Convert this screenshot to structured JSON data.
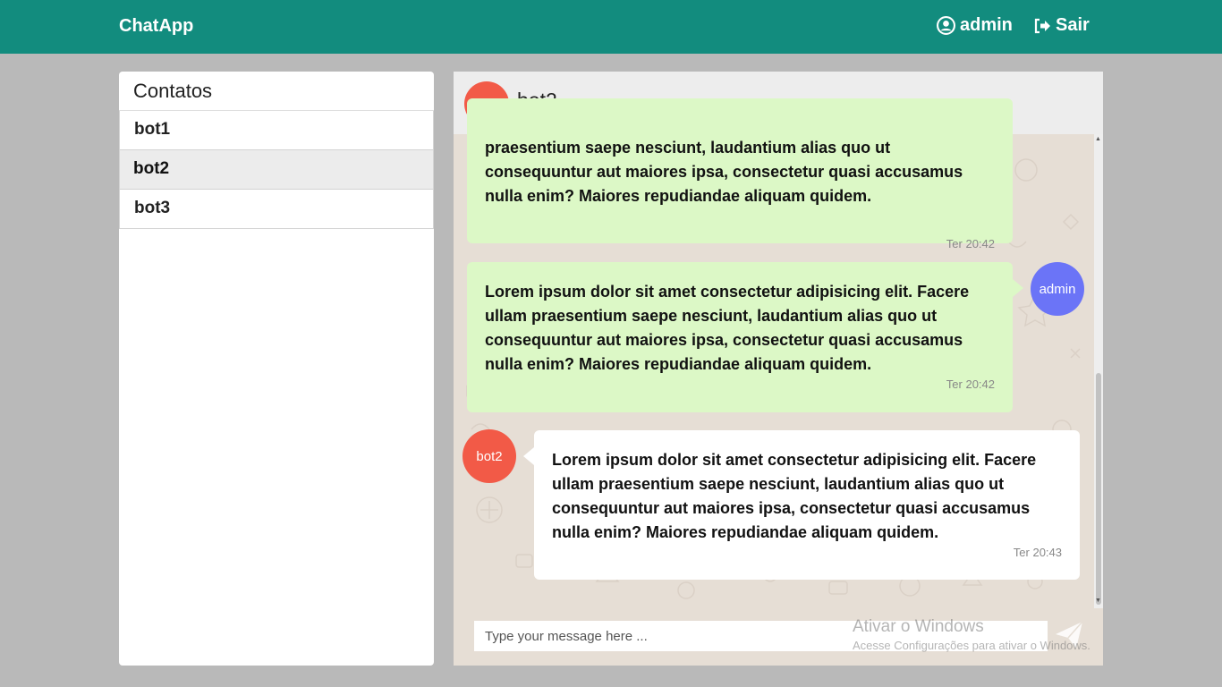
{
  "navbar": {
    "brand": "ChatApp",
    "user_label": "admin",
    "logout_label": "Sair",
    "color": "#128c7e"
  },
  "contacts": {
    "title": "Contatos",
    "items": [
      {
        "label": "bot1",
        "active": false
      },
      {
        "label": "bot2",
        "active": true
      },
      {
        "label": "bot3",
        "active": false
      }
    ]
  },
  "chat": {
    "title": "bot2",
    "avatar_label": "bot2",
    "messages": [
      {
        "direction": "sent",
        "text": "praesentium saepe nesciunt, laudantium alias quo ut consequuntur aut maiores ipsa, consectetur quasi accusamus nulla enim? Maiores repudiandae aliquam quidem.",
        "time": "Ter 20:42"
      },
      {
        "direction": "sent",
        "avatar": "admin",
        "text": "Lorem ipsum dolor sit amet consectetur adipisicing elit. Facere ullam praesentium saepe nesciunt, laudantium alias quo ut consequuntur aut maiores ipsa, consectetur quasi accusamus nulla enim? Maiores repudiandae aliquam quidem.",
        "time": "Ter 20:42"
      },
      {
        "direction": "received",
        "avatar": "bot2",
        "text": "Lorem ipsum dolor sit amet consectetur adipisicing elit. Facere ullam praesentium saepe nesciunt, laudantium alias quo ut consequuntur aut maiores ipsa, consectetur quasi accusamus nulla enim? Maiores repudiandae aliquam quidem.",
        "time": "Ter 20:43"
      }
    ],
    "composer": {
      "placeholder": "Type your message here ...",
      "value": ""
    },
    "colors": {
      "sent_bubble": "#dcf8c6",
      "received_bubble": "#ffffff",
      "bot_avatar": "#f25a47",
      "admin_avatar": "#6b74f7"
    }
  },
  "watermark": {
    "title": "Ativar o Windows",
    "subtitle": "Acesse Configurações para ativar o Windows."
  }
}
